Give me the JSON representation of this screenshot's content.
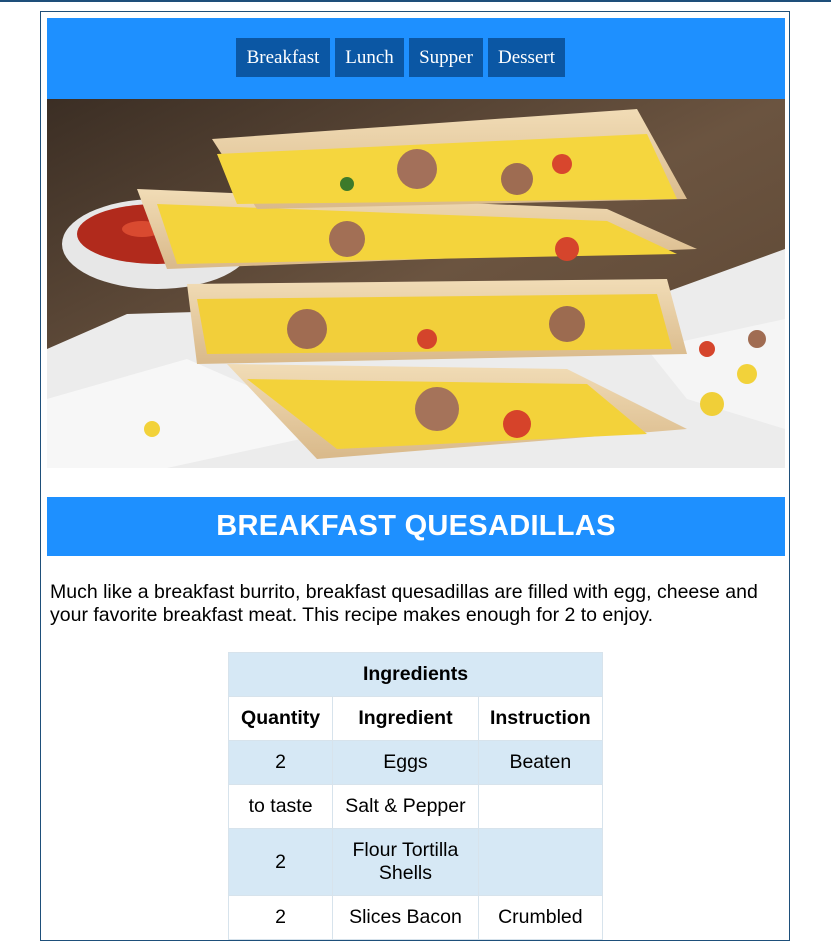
{
  "nav": {
    "items": [
      {
        "label": "Breakfast"
      },
      {
        "label": "Lunch"
      },
      {
        "label": "Supper"
      },
      {
        "label": "Dessert"
      }
    ]
  },
  "hero": {
    "alt": "Stacked breakfast quesadillas with egg, sausage, cheese and tomato"
  },
  "recipe": {
    "title": "BREAKFAST QUESADILLAS",
    "description": "Much like a breakfast burrito, breakfast quesadillas are filled with egg, cheese and your favorite breakfast meat. This recipe makes enough for 2 to enjoy."
  },
  "table": {
    "caption": "Ingredients",
    "headers": [
      "Quantity",
      "Ingredient",
      "Instruction"
    ],
    "rows": [
      {
        "quantity": "2",
        "ingredient": "Eggs",
        "instruction": "Beaten"
      },
      {
        "quantity": "to taste",
        "ingredient": "Salt & Pepper",
        "instruction": ""
      },
      {
        "quantity": "2",
        "ingredient": "Flour Tortilla Shells",
        "instruction": ""
      },
      {
        "quantity": "2",
        "ingredient": "Slices Bacon",
        "instruction": "Crumbled"
      }
    ]
  },
  "colors": {
    "accent": "#1e90ff",
    "nav_button": "#0b57a4",
    "table_stripe": "#d6e8f5"
  }
}
